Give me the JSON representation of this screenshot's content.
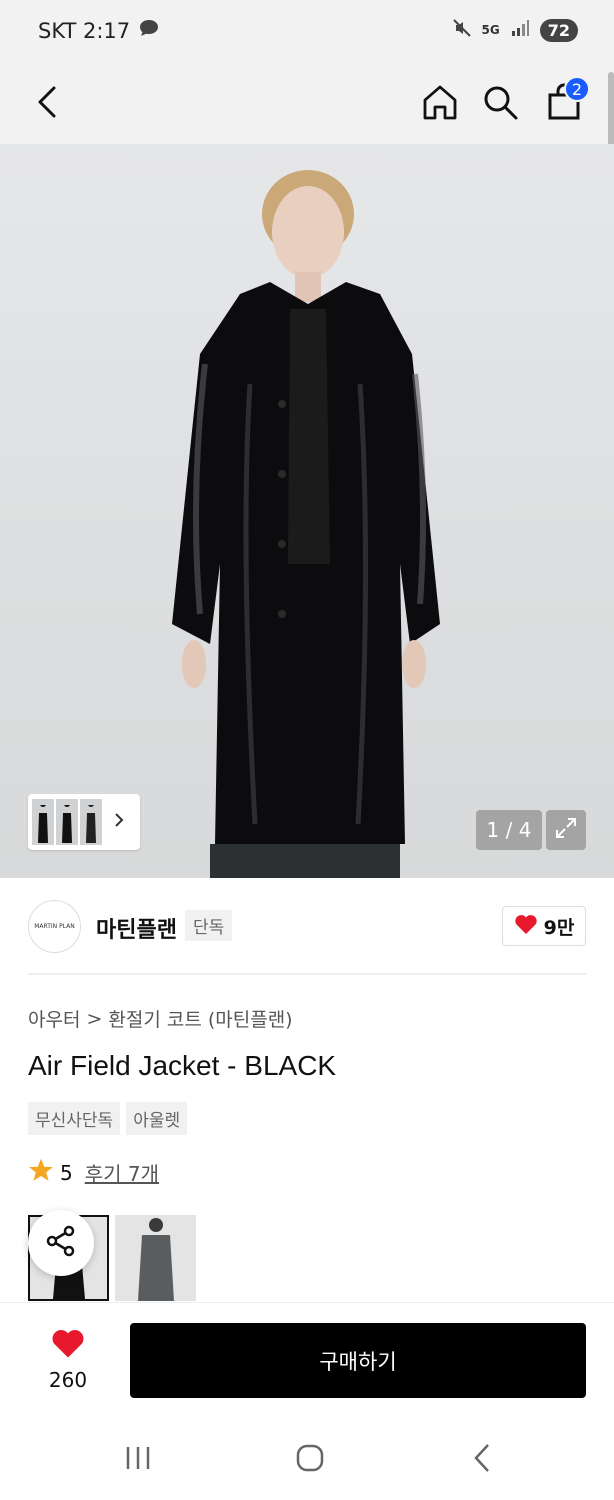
{
  "status_bar": {
    "carrier_time": "SKT 2:17",
    "network": "5G",
    "battery": "72"
  },
  "header": {
    "cart_count": "2"
  },
  "gallery": {
    "counter": "1 / 4"
  },
  "brand": {
    "logo_text": "MARTIN PLAN",
    "name": "마틴플랜",
    "tag": "단독",
    "likes": "9만"
  },
  "breadcrumb": {
    "parent": "아우터",
    "separator": ">",
    "child": "환절기 코트 (마틴플랜)"
  },
  "product": {
    "title": "Air Field Jacket - BLACK",
    "tags": [
      "무신사단독",
      "아울렛"
    ],
    "rating": "5",
    "review_label": "후기 7개"
  },
  "bottom_bar": {
    "like_count": "260",
    "buy_label": "구매하기"
  },
  "colors": {
    "accent_blue": "#1a5cff",
    "heart_red": "#e8192c",
    "star_orange": "#f5a623",
    "buy_bg": "#000000"
  },
  "icons": [
    "back-arrow-icon",
    "home-icon",
    "search-icon",
    "cart-icon",
    "expand-icon",
    "share-icon",
    "heart-icon",
    "star-icon",
    "chevron-right-icon"
  ]
}
